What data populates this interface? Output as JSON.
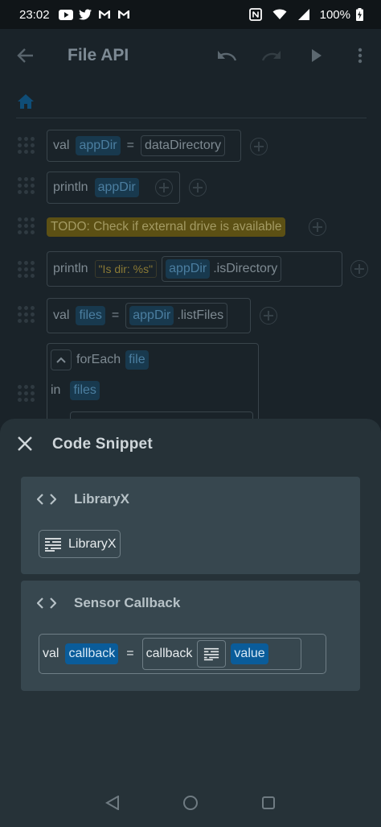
{
  "status": {
    "time": "23:02",
    "battery": "100%"
  },
  "appbar": {
    "title": "File API"
  },
  "editor": {
    "line1": {
      "kw": "val",
      "var": "appDir",
      "eq": "=",
      "value": "dataDirectory"
    },
    "line2": {
      "fn": "println",
      "arg": "appDir"
    },
    "line3": {
      "todo": "TODO: Check if external drive is available"
    },
    "line4": {
      "fn": "println",
      "str": "\"Is dir: %s\"",
      "arg": "appDir",
      "method": ".isDirectory"
    },
    "line5": {
      "kw": "val",
      "var": "files",
      "eq": "=",
      "arg": "appDir",
      "method": ".listFiles"
    },
    "line6": {
      "fn": "forEach",
      "var": "file",
      "in": "in",
      "iter": "files"
    }
  },
  "sheet": {
    "title": "Code Snippet",
    "cards": [
      {
        "title": "LibraryX",
        "snippet": {
          "label": "LibraryX"
        }
      },
      {
        "title": "Sensor Callback",
        "snippet": {
          "kw": "val",
          "var": "callback",
          "eq": "=",
          "fn": "callback",
          "arg": "value"
        }
      }
    ]
  },
  "colors": {
    "accent": "#0a5c9a",
    "sheet_bg": "#263238",
    "card_bg": "#37474f"
  }
}
